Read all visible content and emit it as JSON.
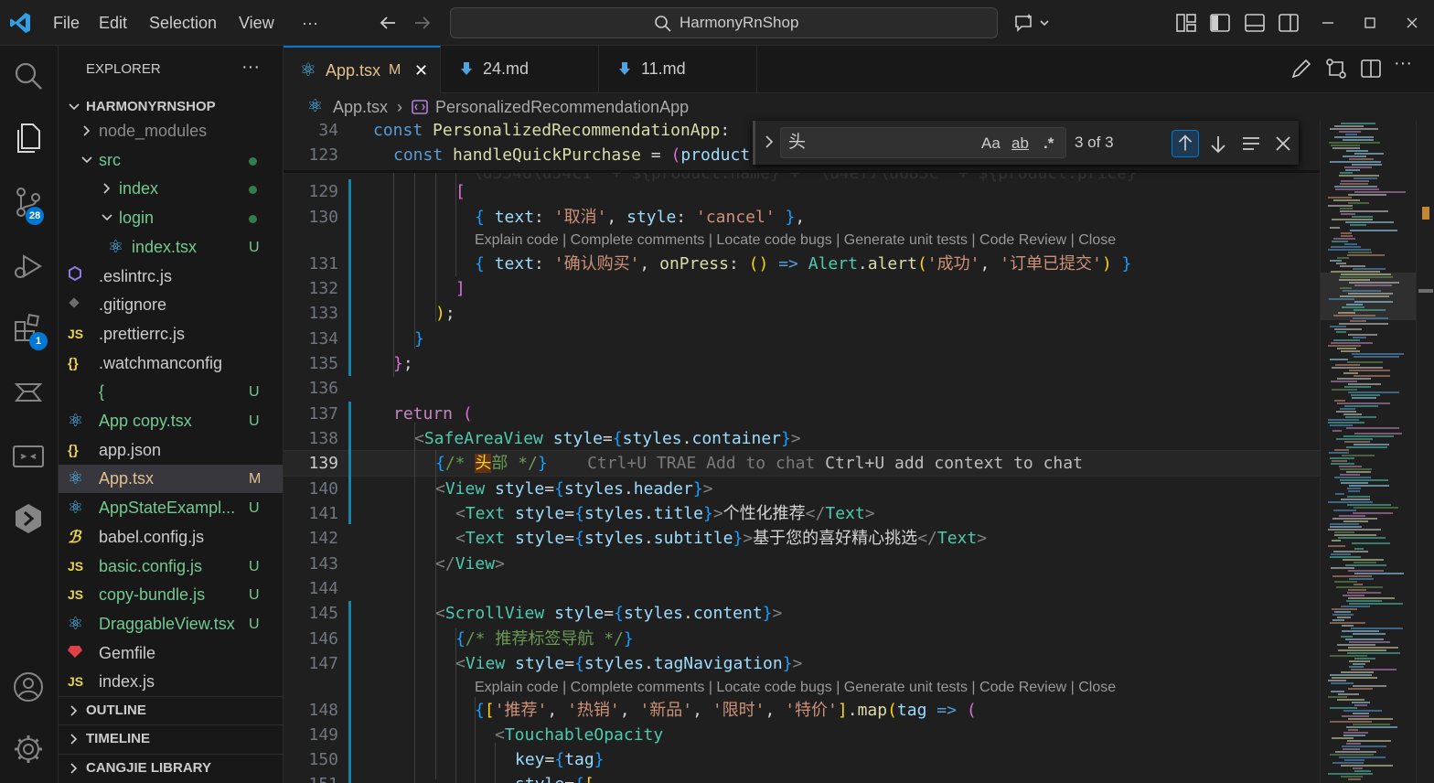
{
  "titlebar": {
    "menus": [
      "File",
      "Edit",
      "Selection",
      "View",
      "···"
    ],
    "search_label": "HarmonyRnShop"
  },
  "activity": {
    "scm_badge": "28",
    "extensions_badge": "1"
  },
  "explorer": {
    "title": "EXPLORER",
    "more": "···",
    "root": "HARMONYRNSHOP",
    "items": [
      {
        "label": "node_modules",
        "status": "",
        "color": "#8b8b8b",
        "icon": "chevron-right"
      },
      {
        "label": "src",
        "status": "",
        "color": "#73c991",
        "icon": "chevron-down"
      },
      {
        "label": "index",
        "status": "",
        "color": "#73c991",
        "icon": "chevron-right"
      },
      {
        "label": "login",
        "status": "",
        "color": "#73c991",
        "icon": "chevron-down"
      },
      {
        "label": "index.tsx",
        "status": "U",
        "color": "#73c991",
        "icon": "react"
      },
      {
        "label": ".eslintrc.js",
        "status": "",
        "color": "#cccccc",
        "icon": "eslint"
      },
      {
        "label": ".gitignore",
        "status": "",
        "color": "#cccccc",
        "icon": "git"
      },
      {
        "label": ".prettierrc.js",
        "status": "",
        "color": "#cccccc",
        "icon": "js"
      },
      {
        "label": ".watchmanconfig",
        "status": "",
        "color": "#cccccc",
        "icon": "json"
      },
      {
        "label": "{",
        "status": "U",
        "color": "#73c991",
        "icon": "file"
      },
      {
        "label": "App copy.tsx",
        "status": "U",
        "color": "#73c991",
        "icon": "react"
      },
      {
        "label": "app.json",
        "status": "",
        "color": "#cccccc",
        "icon": "json"
      },
      {
        "label": "App.tsx",
        "status": "M",
        "color": "#e2c08d",
        "icon": "react"
      },
      {
        "label": "AppStateExampl...",
        "status": "U",
        "color": "#73c991",
        "icon": "react"
      },
      {
        "label": "babel.config.js",
        "status": "",
        "color": "#cccccc",
        "icon": "babel"
      },
      {
        "label": "basic.config.js",
        "status": "U",
        "color": "#73c991",
        "icon": "js"
      },
      {
        "label": "copy-bundle.js",
        "status": "U",
        "color": "#73c991",
        "icon": "js"
      },
      {
        "label": "DraggableView.tsx",
        "status": "U",
        "color": "#73c991",
        "icon": "react"
      },
      {
        "label": "Gemfile",
        "status": "",
        "color": "#cccccc",
        "icon": "ruby"
      },
      {
        "label": "index.js",
        "status": "",
        "color": "#cccccc",
        "icon": "js"
      }
    ],
    "sections": [
      "OUTLINE",
      "TIMELINE",
      "CANGJIE LIBRARY"
    ]
  },
  "tabs": [
    {
      "label": "App.tsx",
      "badge": "M",
      "close": "✕"
    },
    {
      "label": "24.md"
    },
    {
      "label": "11.md"
    }
  ],
  "breadcrumb": {
    "file": "App.tsx",
    "symbol": "PersonalizedRecommendationApp"
  },
  "find": {
    "query": "头",
    "match_case": "Aa",
    "whole_word": "ab",
    "regex": ".*",
    "count": "3 of 3"
  },
  "codelens": "Explain code | Complete comments | Locate code bugs | Generate unit tests | Code Review | Close",
  "ghost": {
    "hint1": "Ctrl+U TRAE Add to chat",
    "hint2": "Ctrl+U add context to chat"
  },
  "code": {
    "sticky1": {
      "ln": "34",
      "text": [
        "const",
        "PersonalizedRecommendationApp:"
      ]
    },
    "sticky2": {
      "ln": "123",
      "text": [
        "const",
        "handleQuickPurchase",
        "=",
        "(",
        "product"
      ]
    },
    "lines": [
      {
        "ln": "129"
      },
      {
        "ln": "130",
        "s1": "'取消'",
        "s2": "'cancel'"
      },
      {
        "ln": "131",
        "s1": "'确认购买'",
        "s2": "'成功'",
        "s3": "'订单已提交'"
      },
      {
        "ln": "132"
      },
      {
        "ln": "133"
      },
      {
        "ln": "134"
      },
      {
        "ln": "135"
      },
      {
        "ln": "136"
      },
      {
        "ln": "137"
      },
      {
        "ln": "138"
      },
      {
        "ln": "139",
        "c1": "/* ",
        "hit": "头",
        "c2": "部 */"
      },
      {
        "ln": "140"
      },
      {
        "ln": "141",
        "t": "个性化推荐"
      },
      {
        "ln": "142",
        "t": "基于您的喜好精心挑选"
      },
      {
        "ln": "143"
      },
      {
        "ln": "144"
      },
      {
        "ln": "145"
      },
      {
        "ln": "146",
        "c": "/* 推荐标签导航 */"
      },
      {
        "ln": "147"
      },
      {
        "ln": "148",
        "tags": [
          "'推荐'",
          "'热销'",
          "'新品'",
          "'限时'",
          "'特价'"
        ]
      },
      {
        "ln": "149"
      },
      {
        "ln": "150"
      }
    ]
  }
}
